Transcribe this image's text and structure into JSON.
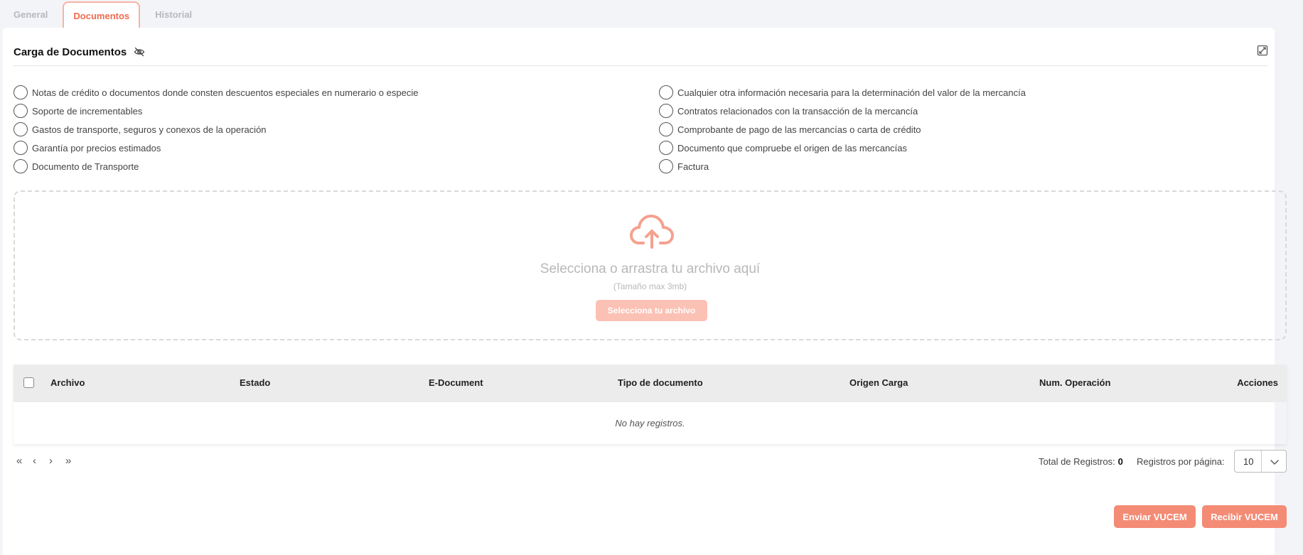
{
  "tabs": [
    {
      "label": "General"
    },
    {
      "label": "Documentos"
    },
    {
      "label": "Historial"
    }
  ],
  "section": {
    "title": "Carga de Documentos",
    "visibility_icon": "eye-off-icon",
    "expand_icon": "expand-icon"
  },
  "documents_left": [
    {
      "label": "Notas de crédito o documentos donde consten descuentos especiales en numerario o especie"
    },
    {
      "label": "Soporte de incrementables"
    },
    {
      "label": "Gastos de transporte, seguros y conexos de la operación"
    },
    {
      "label": "Garantía por precios estimados"
    },
    {
      "label": "Documento de Transporte"
    }
  ],
  "documents_right": [
    {
      "label": "Cualquier otra información necesaria para la determinación del valor de la mercancía"
    },
    {
      "label": "Contratos relacionados con la transacción de la mercancía"
    },
    {
      "label": "Comprobante de pago de las mercancías o carta de crédito"
    },
    {
      "label": "Documento que compruebe el origen de las mercancías"
    },
    {
      "label": "Factura"
    }
  ],
  "dropzone": {
    "icon": "cloud-upload-icon",
    "text": "Selecciona o arrastra tu archivo aquí",
    "subtext": "(Tamaño max 3mb)",
    "button_label": "Selecciona tu archivo"
  },
  "table": {
    "columns": [
      "Archivo",
      "Estado",
      "E-Document",
      "Tipo de documento",
      "Origen Carga",
      "Num. Operación",
      "Acciones"
    ],
    "empty_text": "No hay registros."
  },
  "pagination": {
    "first": "«",
    "prev": "‹",
    "next": "›",
    "last": "»",
    "total_label": "Total de Registros:",
    "total_value": "0",
    "per_page_label": "Registros por página:",
    "per_page_value": "10"
  },
  "actions": {
    "enviar": "Enviar VUCEM",
    "recibir": "Recibir VUCEM"
  },
  "colors": {
    "accent": "#f06a4e",
    "button": "#f48b75",
    "button_disabled": "#fbc1b4",
    "upload_icon": "#f5a18f"
  }
}
